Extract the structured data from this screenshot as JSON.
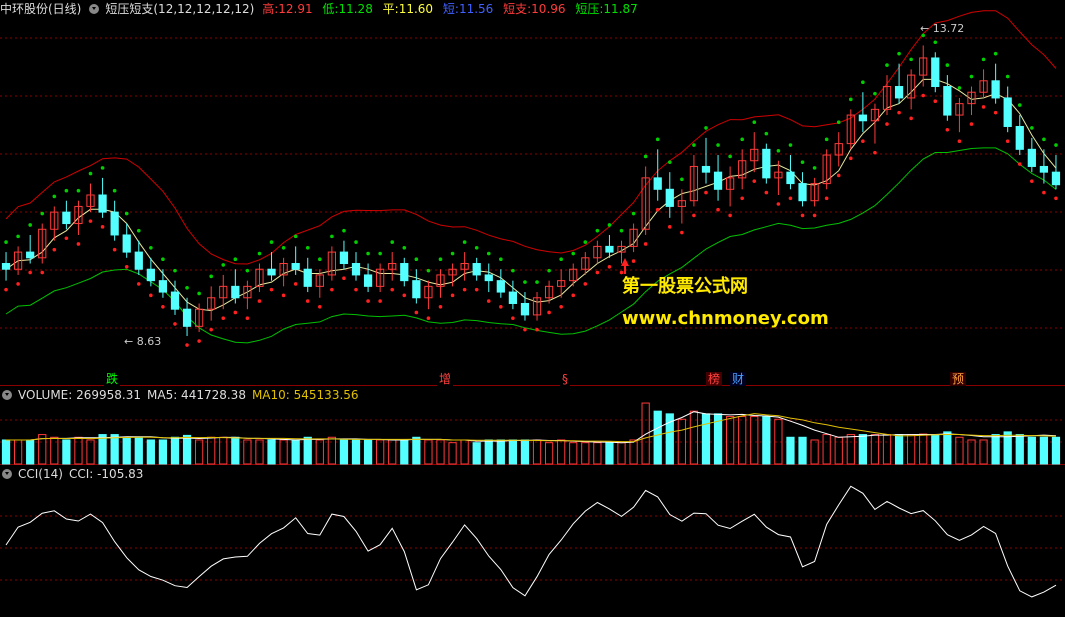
{
  "main_header": {
    "stock_name": "中环股份(日线)",
    "indicator": "短压短支(12,12,12,12,12)",
    "high_label": "高:",
    "high_value": "12.91",
    "low_label": "低:",
    "low_value": "11.28",
    "avg_label": "平:",
    "avg_value": "11.60",
    "short_label": "短:",
    "short_value": "11.56",
    "support_label": "短支:",
    "support_value": "10.96",
    "resist_label": "短压:",
    "resist_value": "11.87"
  },
  "volume_header": {
    "title": "VOLUME: 269958.31",
    "ma5": "MA5: 441728.38",
    "ma10": "MA10: 545133.56"
  },
  "cci_header": {
    "title": "CCI(14)",
    "value": "CCI: -105.83"
  },
  "price_labels": {
    "high": "13.72",
    "low": "8.63"
  },
  "watermark": {
    "line1": "第一股票公式网",
    "line2": "www.chnmoney.com"
  },
  "events": [
    {
      "text": "跌",
      "color": "#00ff00"
    },
    {
      "text": "增",
      "color": "#ff4040"
    },
    {
      "text": "§",
      "color": "#ff4040"
    },
    {
      "text": "榜",
      "color": "#ff4040"
    },
    {
      "text": "财",
      "color": "#4aa0ff"
    },
    {
      "text": "预",
      "color": "#ffa040"
    }
  ],
  "colors": {
    "up": "#ff3b3b",
    "down": "#54ffff",
    "upper_band": "#d00000",
    "lower_band": "#00c000",
    "mid_line": "#e8e8a0",
    "cci": "#ffffff",
    "grid": "#8a0000",
    "ma10": "#e0c000",
    "ma5": "#ffffff"
  },
  "chart_data": {
    "type": "candlestick",
    "title": "中环股份(日线)",
    "ohlc": [
      [
        9.9,
        10.1,
        9.6,
        9.8
      ],
      [
        9.8,
        10.2,
        9.7,
        10.1
      ],
      [
        10.1,
        10.4,
        9.9,
        10.0
      ],
      [
        10.0,
        10.6,
        9.9,
        10.5
      ],
      [
        10.5,
        10.9,
        10.3,
        10.8
      ],
      [
        10.8,
        11.0,
        10.5,
        10.6
      ],
      [
        10.6,
        11.0,
        10.4,
        10.9
      ],
      [
        10.9,
        11.3,
        10.8,
        11.1
      ],
      [
        11.1,
        11.4,
        10.7,
        10.8
      ],
      [
        10.8,
        11.0,
        10.3,
        10.4
      ],
      [
        10.4,
        10.6,
        10.0,
        10.1
      ],
      [
        10.1,
        10.3,
        9.7,
        9.8
      ],
      [
        9.8,
        10.0,
        9.5,
        9.6
      ],
      [
        9.6,
        9.8,
        9.3,
        9.4
      ],
      [
        9.4,
        9.6,
        9.0,
        9.1
      ],
      [
        9.1,
        9.3,
        8.63,
        8.8
      ],
      [
        8.8,
        9.2,
        8.7,
        9.1
      ],
      [
        9.1,
        9.5,
        8.9,
        9.3
      ],
      [
        9.3,
        9.7,
        9.1,
        9.5
      ],
      [
        9.5,
        9.8,
        9.2,
        9.3
      ],
      [
        9.3,
        9.6,
        9.1,
        9.5
      ],
      [
        9.5,
        9.9,
        9.4,
        9.8
      ],
      [
        9.8,
        10.1,
        9.6,
        9.7
      ],
      [
        9.7,
        10.0,
        9.5,
        9.9
      ],
      [
        9.9,
        10.2,
        9.7,
        9.8
      ],
      [
        9.8,
        10.0,
        9.4,
        9.5
      ],
      [
        9.5,
        9.8,
        9.3,
        9.7
      ],
      [
        9.7,
        10.2,
        9.6,
        10.1
      ],
      [
        10.1,
        10.3,
        9.8,
        9.9
      ],
      [
        9.9,
        10.1,
        9.6,
        9.7
      ],
      [
        9.7,
        9.9,
        9.4,
        9.5
      ],
      [
        9.5,
        9.9,
        9.4,
        9.8
      ],
      [
        9.8,
        10.1,
        9.6,
        9.9
      ],
      [
        9.9,
        10.0,
        9.5,
        9.6
      ],
      [
        9.6,
        9.8,
        9.2,
        9.3
      ],
      [
        9.3,
        9.6,
        9.1,
        9.5
      ],
      [
        9.5,
        9.8,
        9.3,
        9.7
      ],
      [
        9.7,
        9.9,
        9.5,
        9.8
      ],
      [
        9.8,
        10.1,
        9.6,
        9.9
      ],
      [
        9.9,
        10.0,
        9.6,
        9.7
      ],
      [
        9.7,
        9.9,
        9.4,
        9.6
      ],
      [
        9.6,
        9.8,
        9.3,
        9.4
      ],
      [
        9.4,
        9.6,
        9.1,
        9.2
      ],
      [
        9.2,
        9.4,
        8.9,
        9.0
      ],
      [
        9.0,
        9.4,
        8.9,
        9.3
      ],
      [
        9.3,
        9.6,
        9.2,
        9.5
      ],
      [
        9.5,
        9.8,
        9.3,
        9.6
      ],
      [
        9.6,
        9.9,
        9.5,
        9.8
      ],
      [
        9.8,
        10.1,
        9.7,
        10.0
      ],
      [
        10.0,
        10.3,
        9.9,
        10.2
      ],
      [
        10.2,
        10.4,
        10.0,
        10.1
      ],
      [
        10.1,
        10.3,
        9.9,
        10.2
      ],
      [
        10.2,
        10.6,
        10.1,
        10.5
      ],
      [
        10.5,
        11.6,
        10.4,
        11.4
      ],
      [
        11.4,
        11.9,
        11.0,
        11.2
      ],
      [
        11.2,
        11.5,
        10.7,
        10.9
      ],
      [
        10.9,
        11.2,
        10.6,
        11.0
      ],
      [
        11.0,
        11.8,
        10.9,
        11.6
      ],
      [
        11.6,
        12.1,
        11.3,
        11.5
      ],
      [
        11.5,
        11.8,
        11.0,
        11.2
      ],
      [
        11.2,
        11.6,
        10.9,
        11.4
      ],
      [
        11.4,
        11.9,
        11.2,
        11.7
      ],
      [
        11.7,
        12.2,
        11.5,
        11.9
      ],
      [
        11.9,
        12.0,
        11.3,
        11.4
      ],
      [
        11.4,
        11.7,
        11.1,
        11.5
      ],
      [
        11.5,
        11.8,
        11.2,
        11.3
      ],
      [
        11.3,
        11.5,
        10.9,
        11.0
      ],
      [
        11.0,
        11.4,
        10.9,
        11.3
      ],
      [
        11.3,
        11.9,
        11.2,
        11.8
      ],
      [
        11.8,
        12.2,
        11.6,
        12.0
      ],
      [
        12.0,
        12.6,
        11.9,
        12.5
      ],
      [
        12.5,
        12.9,
        12.2,
        12.4
      ],
      [
        12.4,
        12.7,
        12.0,
        12.6
      ],
      [
        12.6,
        13.2,
        12.5,
        13.0
      ],
      [
        13.0,
        13.4,
        12.7,
        12.8
      ],
      [
        12.8,
        13.3,
        12.6,
        13.2
      ],
      [
        13.2,
        13.72,
        13.0,
        13.5
      ],
      [
        13.5,
        13.6,
        12.9,
        13.0
      ],
      [
        13.0,
        13.2,
        12.4,
        12.5
      ],
      [
        12.5,
        12.8,
        12.2,
        12.7
      ],
      [
        12.7,
        13.0,
        12.5,
        12.9
      ],
      [
        12.9,
        13.3,
        12.8,
        13.1
      ],
      [
        13.1,
        13.4,
        12.7,
        12.8
      ],
      [
        12.8,
        13.0,
        12.2,
        12.3
      ],
      [
        12.3,
        12.5,
        11.8,
        11.9
      ],
      [
        11.9,
        12.1,
        11.5,
        11.6
      ],
      [
        11.6,
        11.9,
        11.3,
        11.5
      ],
      [
        11.5,
        11.8,
        11.2,
        11.28
      ]
    ],
    "ylim": [
      8.0,
      14.2
    ]
  }
}
